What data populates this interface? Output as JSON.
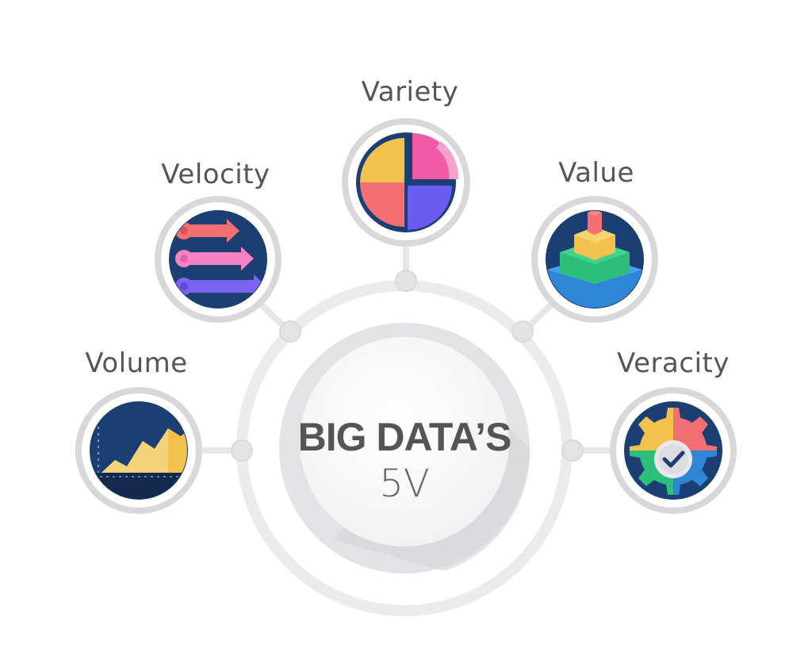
{
  "center": {
    "title": "BIG DATA’S",
    "subtitle": "5V"
  },
  "nodes": {
    "volume": {
      "label": "Volume"
    },
    "velocity": {
      "label": "Velocity"
    },
    "variety": {
      "label": "Variety"
    },
    "value": {
      "label": "Value"
    },
    "veracity": {
      "label": "Veracity"
    }
  },
  "colors": {
    "ring": "#ebebed",
    "node_bg": "#d8d8db",
    "icon_bg": "#1b3f73",
    "text": "#555555"
  }
}
